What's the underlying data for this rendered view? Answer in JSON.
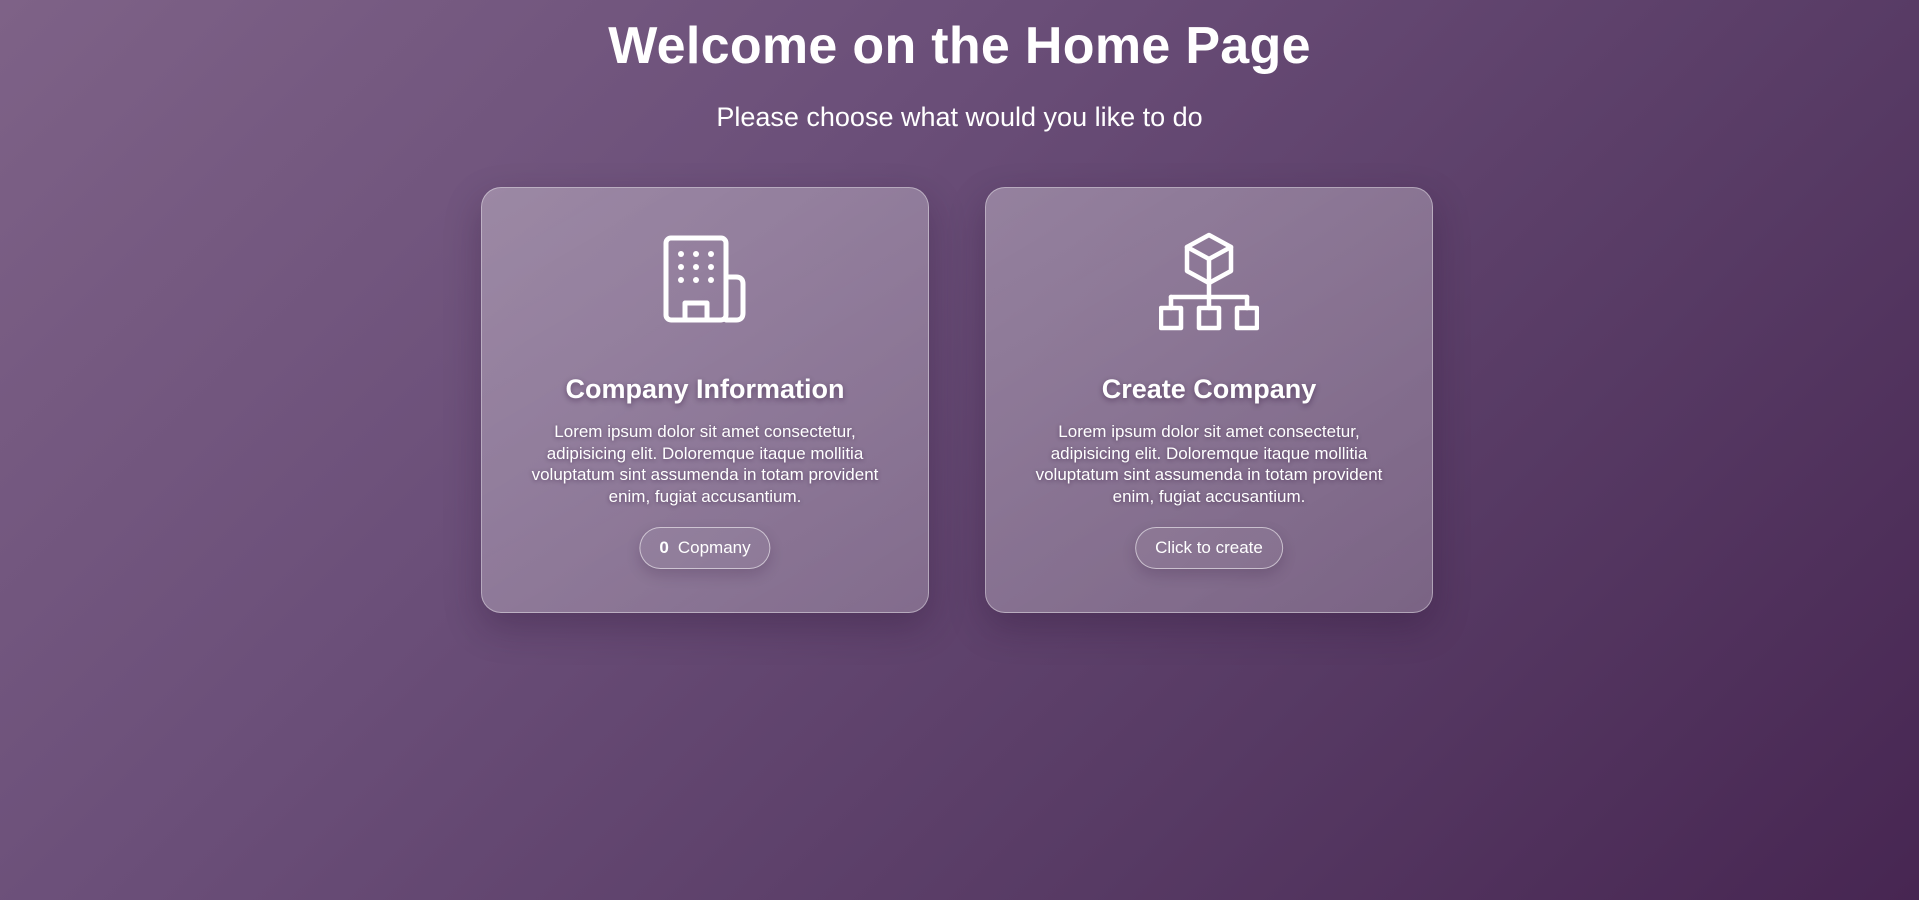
{
  "header": {
    "title": "Welcome on the Home Page",
    "subtitle": "Please choose what would you like to do"
  },
  "cards": [
    {
      "icon": "building-icon",
      "title": "Company Information",
      "description": "Lorem ipsum dolor sit amet consectetur, adipisicing elit. Doloremque itaque mollitia voluptatum sint assumenda in totam provident enim, fugiat accusantium.",
      "button": {
        "count": "0",
        "label": "Copmany"
      }
    },
    {
      "icon": "hierarchy-icon",
      "title": "Create Company",
      "description": "Lorem ipsum dolor sit amet consectetur, adipisicing elit. Doloremque itaque mollitia voluptatum sint assumenda in totam provident enim, fugiat accusantium.",
      "button": {
        "label": "Click to create"
      }
    }
  ]
}
